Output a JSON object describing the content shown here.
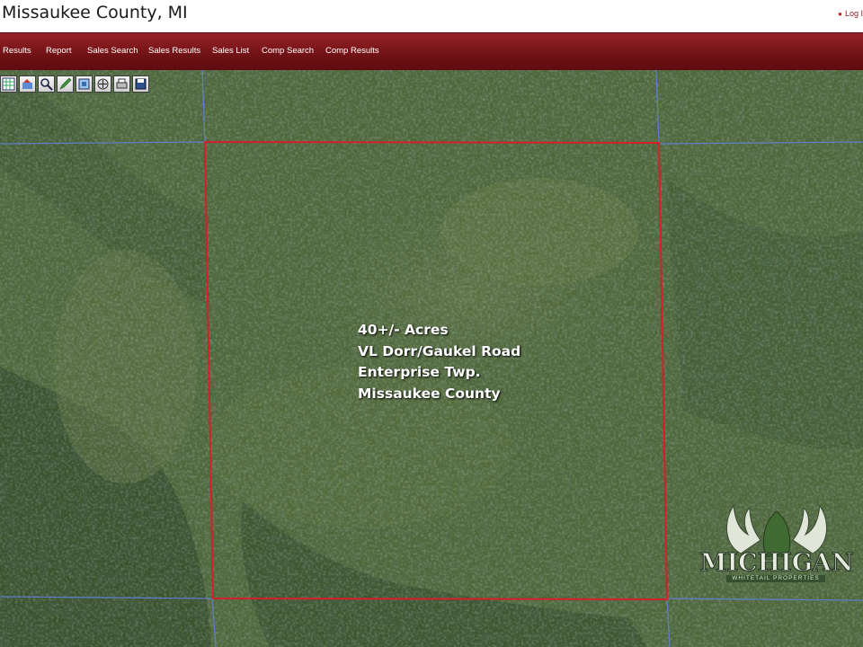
{
  "header": {
    "title": "Missaukee County, MI",
    "login_label": "Log I"
  },
  "nav": {
    "items": [
      "Results",
      "Report",
      "Sales Search",
      "Sales Results",
      "Sales List",
      "Comp Search",
      "Comp Results"
    ]
  },
  "toolbar": {
    "tools": [
      "layers-icon",
      "parcels-icon",
      "zoom-icon",
      "draw-icon",
      "measure-icon",
      "pan-icon",
      "print-icon",
      "save-icon"
    ]
  },
  "map": {
    "caption": [
      "40+/- Acres",
      "VL Dorr/Gaukel Road",
      "Enterprise Twp.",
      "Missaukee County"
    ],
    "boundary_color": "#d61f2a",
    "parcel_line_color": "#5f82d6",
    "logo_text": "MICHIGAN",
    "logo_subtext": "WHITETAIL PROPERTIES"
  },
  "colors": {
    "nav_bg": "#7a161b",
    "forest_dark": "#2f4524",
    "forest_light": "#5e7444"
  }
}
